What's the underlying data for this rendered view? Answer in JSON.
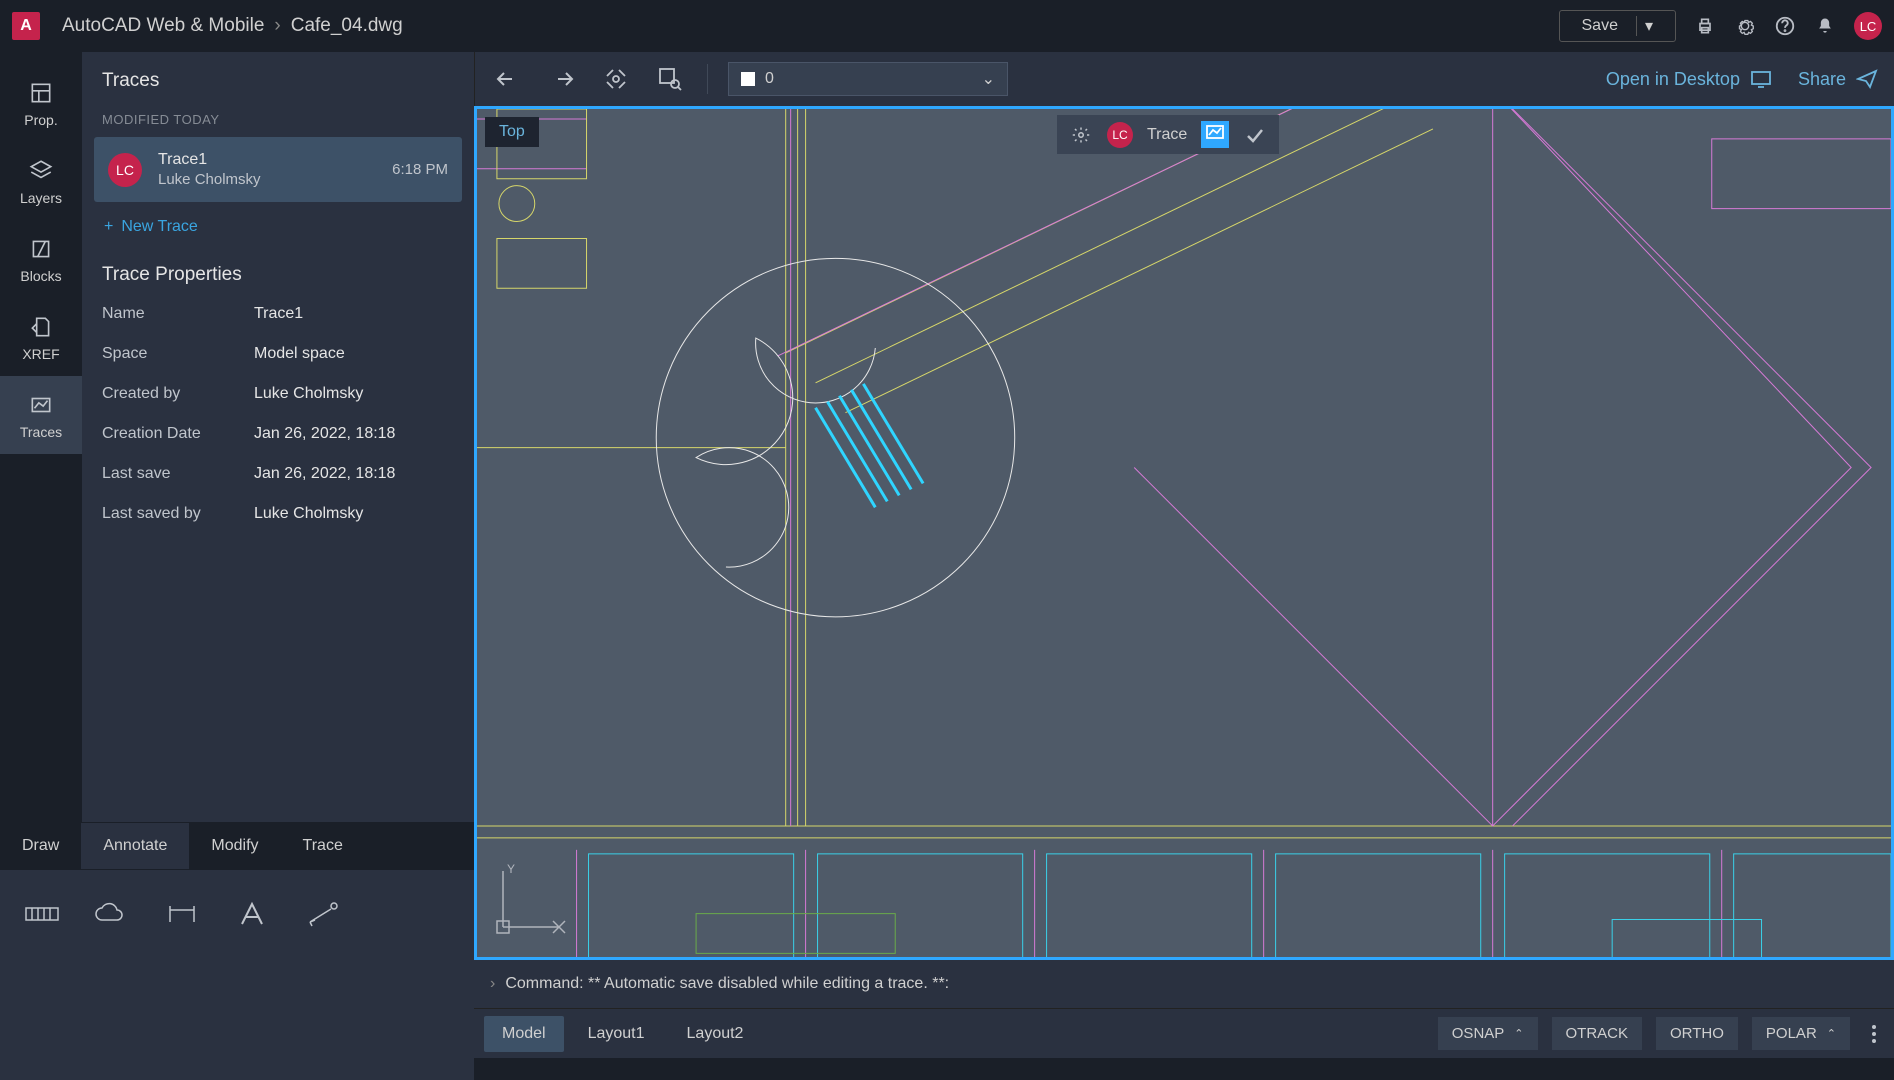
{
  "app": {
    "name": "AutoCAD Web & Mobile",
    "file": "Cafe_04.dwg",
    "avatar": "LC"
  },
  "header": {
    "save": "Save",
    "open_desktop": "Open in Desktop",
    "share": "Share"
  },
  "rail": [
    {
      "id": "prop",
      "label": "Prop."
    },
    {
      "id": "layers",
      "label": "Layers"
    },
    {
      "id": "blocks",
      "label": "Blocks"
    },
    {
      "id": "xref",
      "label": "XREF"
    },
    {
      "id": "traces",
      "label": "Traces"
    }
  ],
  "panel": {
    "title": "Traces",
    "subhead": "MODIFIED TODAY",
    "trace": {
      "name": "Trace1",
      "author": "Luke Cholmsky",
      "time": "6:18 PM",
      "initials": "LC"
    },
    "new_trace": "New Trace",
    "props_title": "Trace Properties",
    "props": [
      {
        "label": "Name",
        "value": "Trace1"
      },
      {
        "label": "Space",
        "value": "Model space"
      },
      {
        "label": "Created by",
        "value": "Luke Cholmsky"
      },
      {
        "label": "Creation Date",
        "value": "Jan 26, 2022, 18:18"
      },
      {
        "label": "Last save",
        "value": "Jan 26, 2022, 18:18"
      },
      {
        "label": "Last saved by",
        "value": "Luke Cholmsky"
      }
    ]
  },
  "tool_tabs": [
    "Draw",
    "Annotate",
    "Modify",
    "Trace"
  ],
  "layer": {
    "name": "0"
  },
  "view": {
    "label": "Top"
  },
  "trace_bar": {
    "label": "Trace",
    "initials": "LC"
  },
  "cmd": {
    "text": "Command: ** Automatic save disabled while editing a trace. **:"
  },
  "layouts": [
    "Model",
    "Layout1",
    "Layout2"
  ],
  "status": [
    "OSNAP",
    "OTRACK",
    "ORTHO",
    "POLAR"
  ],
  "colors": {
    "accent": "#2fa8ff",
    "brand": "#c5234c",
    "link": "#6ab4dc"
  }
}
